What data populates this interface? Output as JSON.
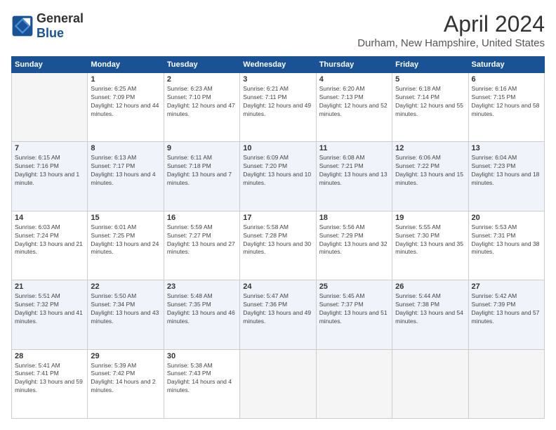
{
  "header": {
    "logo_general": "General",
    "logo_blue": "Blue",
    "month_title": "April 2024",
    "location": "Durham, New Hampshire, United States"
  },
  "days_of_week": [
    "Sunday",
    "Monday",
    "Tuesday",
    "Wednesday",
    "Thursday",
    "Friday",
    "Saturday"
  ],
  "weeks": [
    [
      {
        "day": "",
        "empty": true
      },
      {
        "day": "1",
        "sunrise": "Sunrise: 6:25 AM",
        "sunset": "Sunset: 7:09 PM",
        "daylight": "Daylight: 12 hours and 44 minutes."
      },
      {
        "day": "2",
        "sunrise": "Sunrise: 6:23 AM",
        "sunset": "Sunset: 7:10 PM",
        "daylight": "Daylight: 12 hours and 47 minutes."
      },
      {
        "day": "3",
        "sunrise": "Sunrise: 6:21 AM",
        "sunset": "Sunset: 7:11 PM",
        "daylight": "Daylight: 12 hours and 49 minutes."
      },
      {
        "day": "4",
        "sunrise": "Sunrise: 6:20 AM",
        "sunset": "Sunset: 7:13 PM",
        "daylight": "Daylight: 12 hours and 52 minutes."
      },
      {
        "day": "5",
        "sunrise": "Sunrise: 6:18 AM",
        "sunset": "Sunset: 7:14 PM",
        "daylight": "Daylight: 12 hours and 55 minutes."
      },
      {
        "day": "6",
        "sunrise": "Sunrise: 6:16 AM",
        "sunset": "Sunset: 7:15 PM",
        "daylight": "Daylight: 12 hours and 58 minutes."
      }
    ],
    [
      {
        "day": "7",
        "sunrise": "Sunrise: 6:15 AM",
        "sunset": "Sunset: 7:16 PM",
        "daylight": "Daylight: 13 hours and 1 minute."
      },
      {
        "day": "8",
        "sunrise": "Sunrise: 6:13 AM",
        "sunset": "Sunset: 7:17 PM",
        "daylight": "Daylight: 13 hours and 4 minutes."
      },
      {
        "day": "9",
        "sunrise": "Sunrise: 6:11 AM",
        "sunset": "Sunset: 7:18 PM",
        "daylight": "Daylight: 13 hours and 7 minutes."
      },
      {
        "day": "10",
        "sunrise": "Sunrise: 6:09 AM",
        "sunset": "Sunset: 7:20 PM",
        "daylight": "Daylight: 13 hours and 10 minutes."
      },
      {
        "day": "11",
        "sunrise": "Sunrise: 6:08 AM",
        "sunset": "Sunset: 7:21 PM",
        "daylight": "Daylight: 13 hours and 13 minutes."
      },
      {
        "day": "12",
        "sunrise": "Sunrise: 6:06 AM",
        "sunset": "Sunset: 7:22 PM",
        "daylight": "Daylight: 13 hours and 15 minutes."
      },
      {
        "day": "13",
        "sunrise": "Sunrise: 6:04 AM",
        "sunset": "Sunset: 7:23 PM",
        "daylight": "Daylight: 13 hours and 18 minutes."
      }
    ],
    [
      {
        "day": "14",
        "sunrise": "Sunrise: 6:03 AM",
        "sunset": "Sunset: 7:24 PM",
        "daylight": "Daylight: 13 hours and 21 minutes."
      },
      {
        "day": "15",
        "sunrise": "Sunrise: 6:01 AM",
        "sunset": "Sunset: 7:25 PM",
        "daylight": "Daylight: 13 hours and 24 minutes."
      },
      {
        "day": "16",
        "sunrise": "Sunrise: 5:59 AM",
        "sunset": "Sunset: 7:27 PM",
        "daylight": "Daylight: 13 hours and 27 minutes."
      },
      {
        "day": "17",
        "sunrise": "Sunrise: 5:58 AM",
        "sunset": "Sunset: 7:28 PM",
        "daylight": "Daylight: 13 hours and 30 minutes."
      },
      {
        "day": "18",
        "sunrise": "Sunrise: 5:56 AM",
        "sunset": "Sunset: 7:29 PM",
        "daylight": "Daylight: 13 hours and 32 minutes."
      },
      {
        "day": "19",
        "sunrise": "Sunrise: 5:55 AM",
        "sunset": "Sunset: 7:30 PM",
        "daylight": "Daylight: 13 hours and 35 minutes."
      },
      {
        "day": "20",
        "sunrise": "Sunrise: 5:53 AM",
        "sunset": "Sunset: 7:31 PM",
        "daylight": "Daylight: 13 hours and 38 minutes."
      }
    ],
    [
      {
        "day": "21",
        "sunrise": "Sunrise: 5:51 AM",
        "sunset": "Sunset: 7:32 PM",
        "daylight": "Daylight: 13 hours and 41 minutes."
      },
      {
        "day": "22",
        "sunrise": "Sunrise: 5:50 AM",
        "sunset": "Sunset: 7:34 PM",
        "daylight": "Daylight: 13 hours and 43 minutes."
      },
      {
        "day": "23",
        "sunrise": "Sunrise: 5:48 AM",
        "sunset": "Sunset: 7:35 PM",
        "daylight": "Daylight: 13 hours and 46 minutes."
      },
      {
        "day": "24",
        "sunrise": "Sunrise: 5:47 AM",
        "sunset": "Sunset: 7:36 PM",
        "daylight": "Daylight: 13 hours and 49 minutes."
      },
      {
        "day": "25",
        "sunrise": "Sunrise: 5:45 AM",
        "sunset": "Sunset: 7:37 PM",
        "daylight": "Daylight: 13 hours and 51 minutes."
      },
      {
        "day": "26",
        "sunrise": "Sunrise: 5:44 AM",
        "sunset": "Sunset: 7:38 PM",
        "daylight": "Daylight: 13 hours and 54 minutes."
      },
      {
        "day": "27",
        "sunrise": "Sunrise: 5:42 AM",
        "sunset": "Sunset: 7:39 PM",
        "daylight": "Daylight: 13 hours and 57 minutes."
      }
    ],
    [
      {
        "day": "28",
        "sunrise": "Sunrise: 5:41 AM",
        "sunset": "Sunset: 7:41 PM",
        "daylight": "Daylight: 13 hours and 59 minutes."
      },
      {
        "day": "29",
        "sunrise": "Sunrise: 5:39 AM",
        "sunset": "Sunset: 7:42 PM",
        "daylight": "Daylight: 14 hours and 2 minutes."
      },
      {
        "day": "30",
        "sunrise": "Sunrise: 5:38 AM",
        "sunset": "Sunset: 7:43 PM",
        "daylight": "Daylight: 14 hours and 4 minutes."
      },
      {
        "day": "",
        "empty": true
      },
      {
        "day": "",
        "empty": true
      },
      {
        "day": "",
        "empty": true
      },
      {
        "day": "",
        "empty": true
      }
    ]
  ]
}
